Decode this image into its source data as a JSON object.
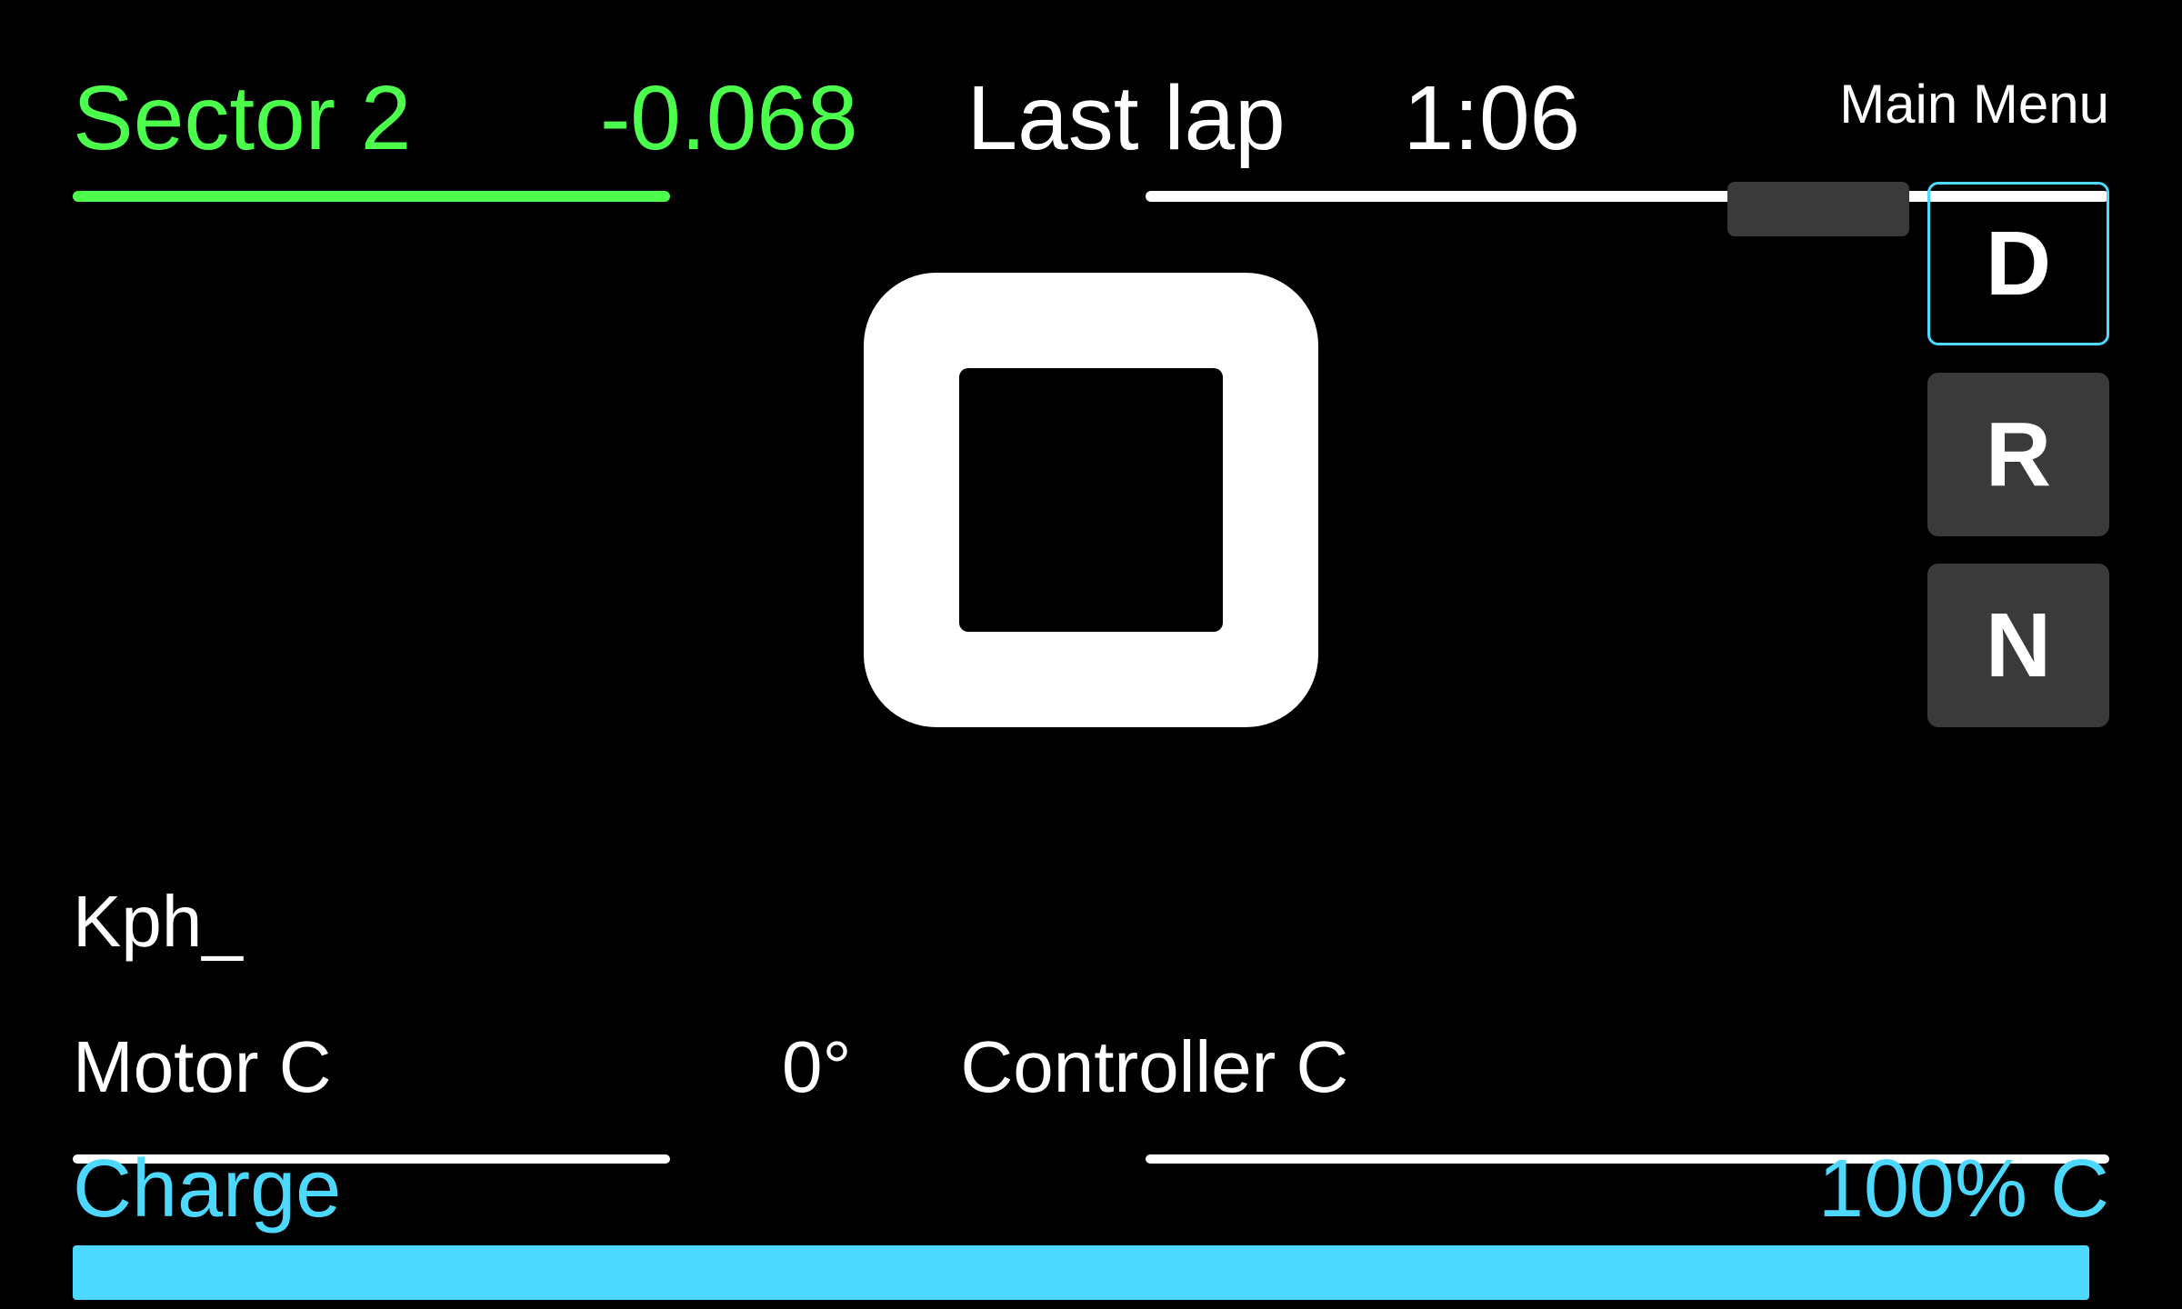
{
  "header": {
    "sector_label": "Sector 2",
    "sector_time": "-0.068",
    "last_lap_label": "Last lap",
    "last_lap_time": "1:06",
    "main_menu_label": "Main Menu"
  },
  "progress": {
    "sector_bar_width": "62%",
    "last_lap_bar_width": "100%"
  },
  "gear_buttons": {
    "d_label": "D",
    "r_label": "R",
    "n_label": "N"
  },
  "speed": {
    "label": "Kph_"
  },
  "motor": {
    "label": "Motor C",
    "temp": "0°",
    "bar_width": "62%"
  },
  "controller": {
    "label": "Controller C",
    "bar_width": "100%"
  },
  "charge": {
    "label": "Charge",
    "percent": "100% C",
    "bar_width": "99%"
  },
  "colors": {
    "green": "#4cff4c",
    "cyan": "#4dd9ff",
    "white": "#ffffff",
    "dark_bg": "#000000",
    "dark_btn": "#3a3a3a"
  }
}
